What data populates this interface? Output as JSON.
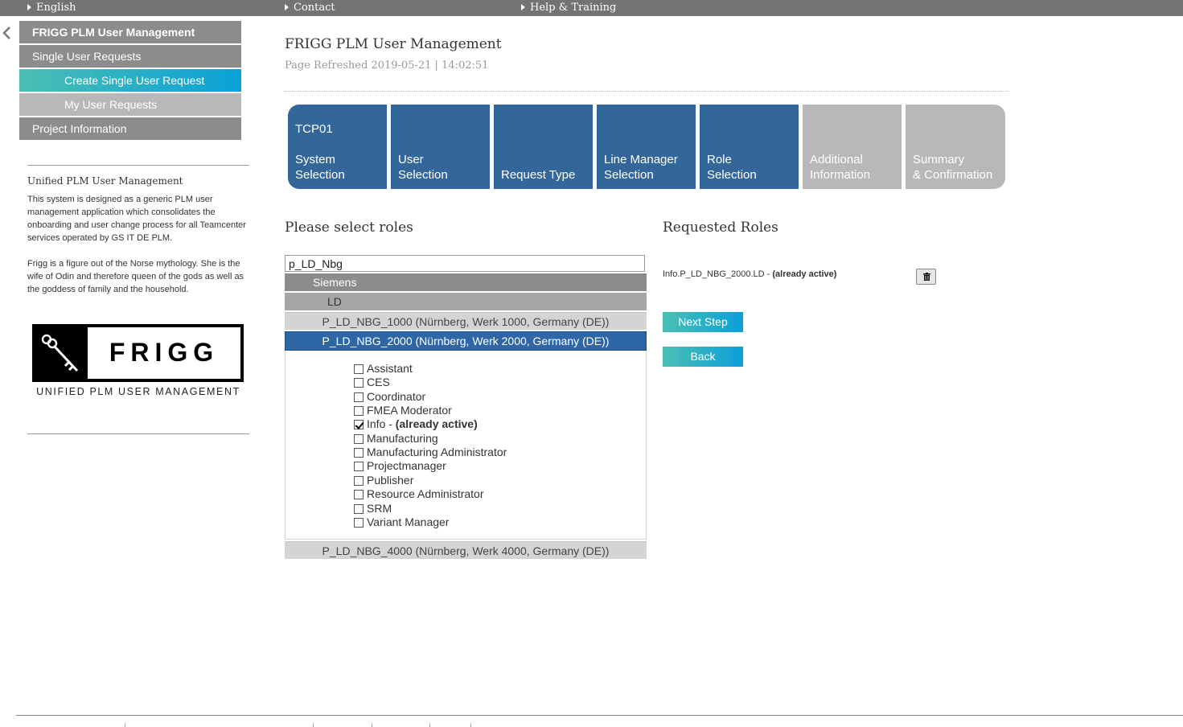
{
  "topbar": {
    "language": "English",
    "contact": "Contact",
    "help": "Help & Training"
  },
  "nav": {
    "main_title": "FRIGG PLM User Management",
    "single_user_requests": "Single User Requests",
    "create_single_user_request": "Create Single User Request",
    "my_user_requests": "My User Requests",
    "project_information": "Project Information"
  },
  "sidebar": {
    "title": "Unified PLM User Management",
    "paragraph1": "This system is designed as a generic PLM user management application which consolidates the onboarding and user change process for all Teamcenter services operated by GS IT DE PLM.",
    "paragraph2": "Frigg is a figure out of the Norse mythology. She is the wife of Odin and therefore queen of the gods as well as the goddess of family and the household.",
    "logo_word": "FRIGG",
    "logo_tagline": "UNIFIED PLM USER MANAGEMENT"
  },
  "header": {
    "title": "FRIGG PLM User Management",
    "refreshed": "Page Refreshed 2019-05-21 | 14:02:51"
  },
  "steps": [
    {
      "code": "TCP01",
      "label": "System\nSelection",
      "state": "done"
    },
    {
      "code": "",
      "label": "User\nSelection",
      "state": "done"
    },
    {
      "code": "",
      "label": "Request Type",
      "state": "done"
    },
    {
      "code": "",
      "label": "Line Manager\nSelection",
      "state": "done"
    },
    {
      "code": "",
      "label": "Role\nSelection",
      "state": "done"
    },
    {
      "code": "",
      "label": "Additional\nInformation",
      "state": "todo"
    },
    {
      "code": "",
      "label": "Summary\n& Confirmation",
      "state": "todo"
    }
  ],
  "roles_section": {
    "title": "Please select roles",
    "search_value": "p_LD_Nbg",
    "tree": {
      "org": "Siemens",
      "division": "LD",
      "groups": [
        "P_LD_NBG_1000 (Nürnberg, Werk 1000, Germany (DE))",
        "P_LD_NBG_2000 (Nürnberg, Werk 2000, Germany (DE))",
        "P_LD_NBG_4000 (Nürnberg, Werk 4000, Germany (DE))"
      ]
    },
    "roles": [
      {
        "name": "Assistant",
        "checked": false,
        "note": ""
      },
      {
        "name": "CES",
        "checked": false,
        "note": ""
      },
      {
        "name": "Coordinator",
        "checked": false,
        "note": ""
      },
      {
        "name": "FMEA Moderator",
        "checked": false,
        "note": ""
      },
      {
        "name": "Info - ",
        "checked": true,
        "note": "(already active)"
      },
      {
        "name": "Manufacturing",
        "checked": false,
        "note": ""
      },
      {
        "name": "Manufacturing Administrator",
        "checked": false,
        "note": ""
      },
      {
        "name": "Projectmanager",
        "checked": false,
        "note": ""
      },
      {
        "name": "Publisher",
        "checked": false,
        "note": ""
      },
      {
        "name": "Resource Administrator",
        "checked": false,
        "note": ""
      },
      {
        "name": "SRM",
        "checked": false,
        "note": ""
      },
      {
        "name": "Variant Manager",
        "checked": false,
        "note": ""
      }
    ]
  },
  "requested_section": {
    "title": "Requested Roles",
    "item_name": "Info.P_LD_NBG_2000.LD - ",
    "item_note": "(already active)",
    "next_label": "Next Step",
    "back_label": "Back"
  },
  "colors": {
    "step_done": "#336699",
    "step_todo": "#b8b8b8",
    "selected_group": "#2f67a6",
    "accent_gradient_start": "#4bbfb4",
    "accent_gradient_end": "#0aa0d8",
    "topbar": "#737373"
  }
}
